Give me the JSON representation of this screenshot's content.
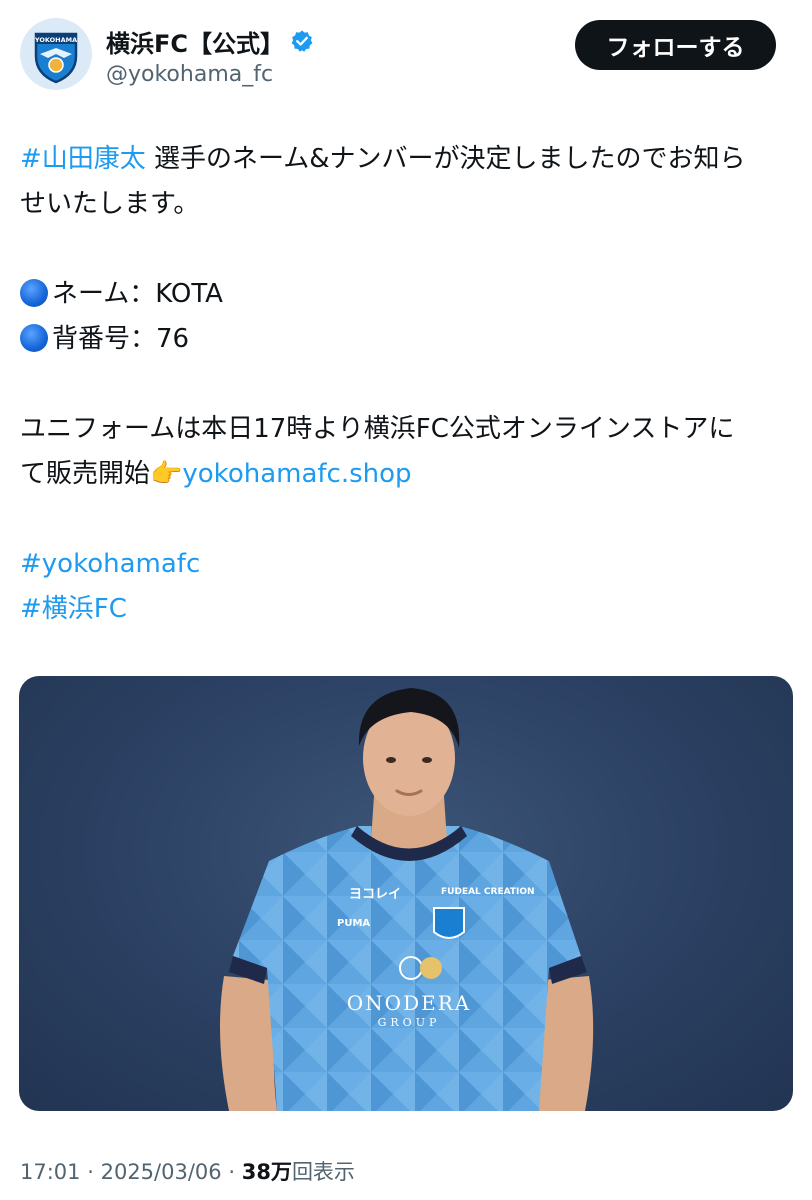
{
  "account": {
    "display_name": "横浜FC【公式】",
    "handle": "@yokohama_fc",
    "avatar_text": "YOKOHAMA"
  },
  "follow_button": {
    "label": "フォローする"
  },
  "tweet": {
    "hashtag_player": "#山田康太",
    "line1_rest": " 選手のネーム&ナンバーが決定しましたのでお知ら",
    "line2": "せいたします。",
    "name_line": "ネーム：KOTA",
    "number_line": "背番号：76",
    "store_line1": "ユニフォームは本日17時より横浜FC公式オンラインストアに",
    "store_line2_text": "て販売開始",
    "pointing_emoji": "👉",
    "store_link": "yokohamafc.shop",
    "hashtag_1": "#yokohamafc",
    "hashtag_2": "#横浜FC"
  },
  "photo": {
    "jersey_sponsor_1": "ヨコレイ",
    "jersey_sponsor_2": "FUDEAL CREATION",
    "jersey_brand": "PUMA",
    "jersey_main_sponsor": "ONODERA",
    "jersey_main_sponsor_sub": "GROUP"
  },
  "meta": {
    "time": "17:01",
    "separator": "·",
    "date": "2025/03/06",
    "views_count": "38万",
    "views_label": "回表示"
  },
  "colors": {
    "link": "#1d9bf0",
    "verified": "#1d9bf0",
    "button_bg": "#0f1419",
    "jersey": "#5fa6e0",
    "backdrop": "#2b4062"
  },
  "icons": {
    "verified": "verified-badge-icon",
    "bullet": "blue-circle-icon",
    "pointing": "pointing-right-icon"
  }
}
